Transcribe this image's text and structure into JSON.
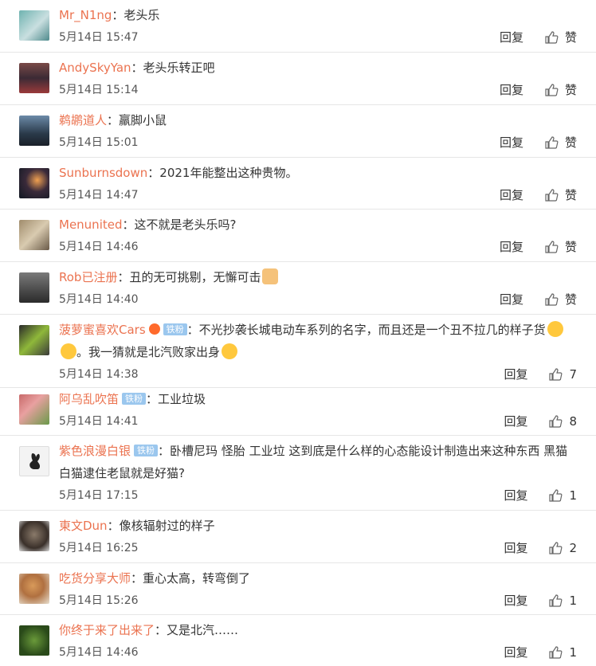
{
  "actions": {
    "reply_label": "回复",
    "like_label": "赞"
  },
  "comments": [
    {
      "user": "Mr_N1ng",
      "sep": "：",
      "text": "老头乐",
      "time": "5月14日 15:47",
      "likes": ""
    },
    {
      "user": "AndySkyYan",
      "sep": "：",
      "text": "老头乐转正吧",
      "time": "5月14日 15:14",
      "likes": ""
    },
    {
      "user": "鹈鹕道人",
      "sep": "：",
      "text": "羸脚小鼠",
      "time": "5月14日 15:01",
      "likes": ""
    },
    {
      "user": "Sunburnsdown",
      "sep": "：",
      "text": "2021年能整出这种贵物。",
      "time": "5月14日 14:47",
      "likes": ""
    },
    {
      "user": "Menunited",
      "sep": "：",
      "text": "这不就是老头乐吗?",
      "time": "5月14日 14:46",
      "likes": ""
    },
    {
      "user": "Rob已注册",
      "sep": "：",
      "text": "丑的无可挑剔，无懈可击",
      "time": "5月14日 14:40",
      "likes": ""
    },
    {
      "user": "菠萝蜜喜欢Cars",
      "badge": "铁粉",
      "sep": "：",
      "text": "不光抄袭长城电动车系列的名字，而且还是一个丑不拉几的样子货",
      "text2": "。我一猜就是北汽败家出身",
      "time": "5月14日 14:38",
      "likes": "7"
    },
    {
      "user": "阿乌乱吹笛",
      "badge": "铁粉",
      "sep": "：",
      "text": "工业垃圾",
      "time": "5月14日 14:41",
      "likes": "8"
    },
    {
      "user": "紫色浪漫白银",
      "badge": "铁粉",
      "sep": "：",
      "text": "卧槽尼玛 怪胎 工业垃 这到底是什么样的心态能设计制造出来这种东西 黑猫白猫逮住老鼠就是好猫?",
      "time": "5月14日 17:15",
      "likes": "1"
    },
    {
      "user": "東文Dun",
      "sep": "：",
      "text": "像核辐射过的样子",
      "time": "5月14日 16:25",
      "likes": "2"
    },
    {
      "user": "吃货分享大师",
      "sep": "：",
      "text": "重心太高，转弯倒了",
      "time": "5月14日 15:26",
      "likes": "1"
    },
    {
      "user": "你终于来了出来了",
      "sep": "：",
      "text": "又是北汽……",
      "time": "5月14日 14:46",
      "likes": "1"
    }
  ]
}
